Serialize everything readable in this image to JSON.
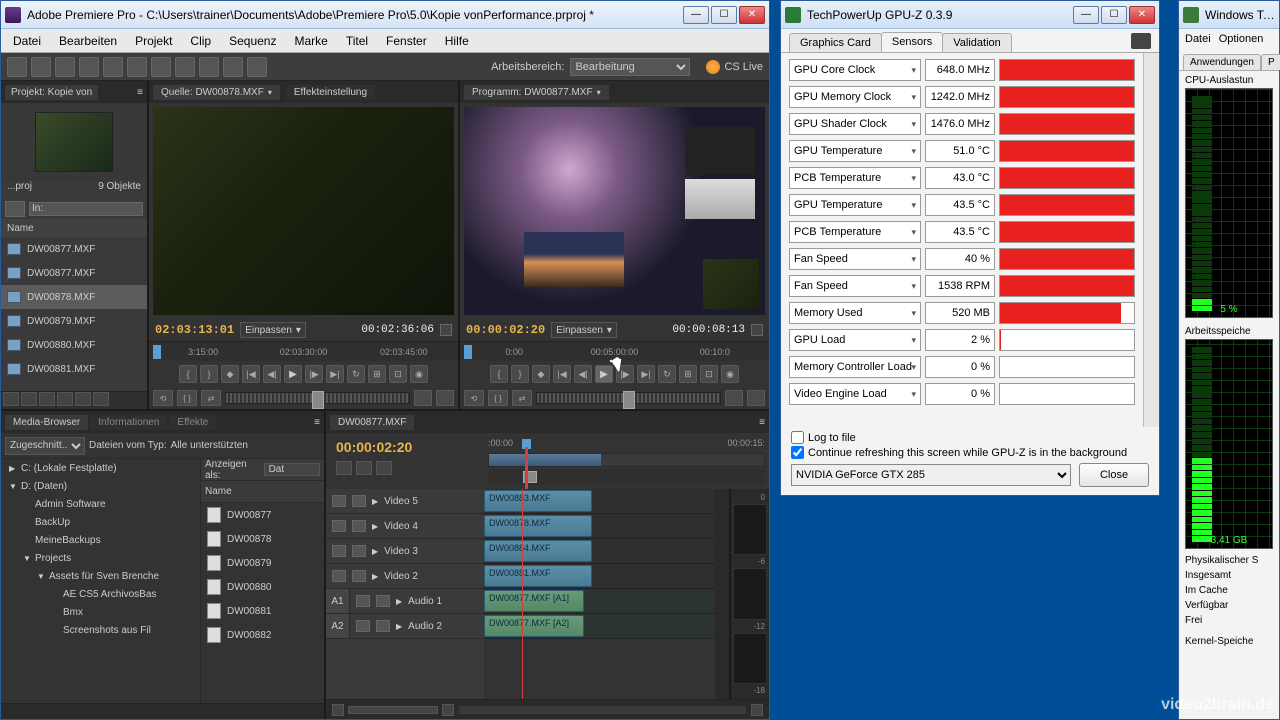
{
  "premiere": {
    "title": "Adobe Premiere Pro - C:\\Users\\trainer\\Documents\\Adobe\\Premiere Pro\\5.0\\Kopie vonPerformance.prproj *",
    "menu": [
      "Datei",
      "Bearbeiten",
      "Projekt",
      "Clip",
      "Sequenz",
      "Marke",
      "Titel",
      "Fenster",
      "Hilfe"
    ],
    "workspace_label": "Arbeitsbereich:",
    "workspace_value": "Bearbeitung",
    "cslive": "CS Live",
    "project": {
      "tab": "Projekt: Kopie von",
      "info_name": "...proj",
      "info_count": "9 Objekte",
      "in_label": "In:",
      "name_col": "Name",
      "items": [
        "DW00877.MXF",
        "DW00877.MXF",
        "DW00878.MXF",
        "DW00879.MXF",
        "DW00880.MXF",
        "DW00881.MXF"
      ],
      "selected_index": 2
    },
    "source": {
      "tab": "Quelle: DW00878.MXF",
      "tab2": "Effekteinstellung",
      "tc_in": "02:03:13:01",
      "fit": "Einpassen",
      "tc_dur": "00:02:36:06",
      "ruler": [
        "3:15:00",
        "02:03:30:00",
        "02:03:45:00"
      ]
    },
    "program": {
      "tab": "Programm: DW00877.MXF",
      "tc_in": "00:00:02:20",
      "fit": "Einpassen",
      "tc_dur": "00:00:08:13",
      "ruler": [
        "0:00",
        "00:05:00:00",
        "00:10:0"
      ]
    },
    "browser": {
      "tabs": [
        "Media-Browser",
        "Informationen",
        "Effekte"
      ],
      "cut": "Zugeschnitt...",
      "filetype_label": "Dateien vom Typ:",
      "filetype_value": "Alle unterstützten",
      "show_as": "Anzeigen als:",
      "show_as_val": "Dat",
      "name_col": "Name",
      "tree": [
        {
          "d": 0,
          "t": "▶",
          "l": "C: (Lokale Festplatte)"
        },
        {
          "d": 0,
          "t": "▼",
          "l": "D: (Daten)"
        },
        {
          "d": 1,
          "t": "",
          "l": "Admin Software"
        },
        {
          "d": 1,
          "t": "",
          "l": "BackUp"
        },
        {
          "d": 1,
          "t": "",
          "l": "MeineBackups"
        },
        {
          "d": 1,
          "t": "▼",
          "l": "Projects"
        },
        {
          "d": 2,
          "t": "▼",
          "l": "Assets für Sven Brenche"
        },
        {
          "d": 3,
          "t": "",
          "l": "AE CS5 ArchivosBas"
        },
        {
          "d": 3,
          "t": "",
          "l": "Bmx"
        },
        {
          "d": 3,
          "t": "",
          "l": "Screenshots aus Fil"
        }
      ],
      "files": [
        "DW00877",
        "DW00878",
        "DW00879",
        "DW00880",
        "DW00881",
        "DW00882"
      ]
    },
    "timeline": {
      "tab": "DW00877.MXF",
      "tc": "00:00:02:20",
      "scale": [
        ":00:00",
        "00:00:15:"
      ],
      "v_tracks": [
        {
          "name": "Video 5",
          "clip": "DW00883.MXF"
        },
        {
          "name": "Video 4",
          "clip": "DW00878.MXF"
        },
        {
          "name": "Video 3",
          "clip": "DW00884.MXF"
        },
        {
          "name": "Video 2",
          "clip": "DW00881.MXF"
        }
      ],
      "a_tracks": [
        {
          "sel": "A1",
          "name": "Audio 1",
          "clip": "DW00877.MXF [A1]"
        },
        {
          "sel": "A2",
          "name": "Audio 2",
          "clip": "DW00877.MXF [A2]"
        }
      ],
      "meter_labels": [
        "0",
        "-6",
        "-12",
        "-18"
      ]
    }
  },
  "gpuz": {
    "title": "TechPowerUp GPU-Z 0.3.9",
    "tabs": [
      "Graphics Card",
      "Sensors",
      "Validation"
    ],
    "active_tab": 1,
    "rows": [
      {
        "name": "GPU Core Clock",
        "val": "648.0 MHz",
        "pct": 100
      },
      {
        "name": "GPU Memory Clock",
        "val": "1242.0 MHz",
        "pct": 100
      },
      {
        "name": "GPU Shader Clock",
        "val": "1476.0 MHz",
        "pct": 100
      },
      {
        "name": "GPU Temperature",
        "val": "51.0 °C",
        "pct": 100
      },
      {
        "name": "PCB Temperature",
        "val": "43.0 °C",
        "pct": 100
      },
      {
        "name": "GPU Temperature",
        "val": "43.5 °C",
        "pct": 100
      },
      {
        "name": "PCB Temperature",
        "val": "43.5 °C",
        "pct": 100
      },
      {
        "name": "Fan Speed",
        "val": "40 %",
        "pct": 100
      },
      {
        "name": "Fan Speed",
        "val": "1538 RPM",
        "pct": 100
      },
      {
        "name": "Memory Used",
        "val": "520 MB",
        "pct": 90
      },
      {
        "name": "GPU Load",
        "val": "2 %",
        "pct": 1
      },
      {
        "name": "Memory Controller Load",
        "val": "0 %",
        "pct": 0
      },
      {
        "name": "Video Engine Load",
        "val": "0 %",
        "pct": 0
      }
    ],
    "log_label": "Log to file",
    "refresh_label": "Continue refreshing this screen while GPU-Z is in the background",
    "gpu": "NVIDIA GeForce GTX 285",
    "close": "Close"
  },
  "taskmgr": {
    "title": "Windows Task",
    "menu": [
      "Datei",
      "Optionen"
    ],
    "tabs": [
      "Anwendungen",
      "P"
    ],
    "cpu_label": "CPU-Auslastun",
    "cpu_pct": "5 %",
    "mem_label": "Arbeitsspeiche",
    "mem_val": "3,41 GB",
    "stats_head": "Physikalischer S",
    "stats": [
      "Insgesamt",
      "Im Cache",
      "Verfügbar",
      "Frei"
    ],
    "footer": "Kernel-Speiche"
  },
  "watermark": "video2brain.de"
}
